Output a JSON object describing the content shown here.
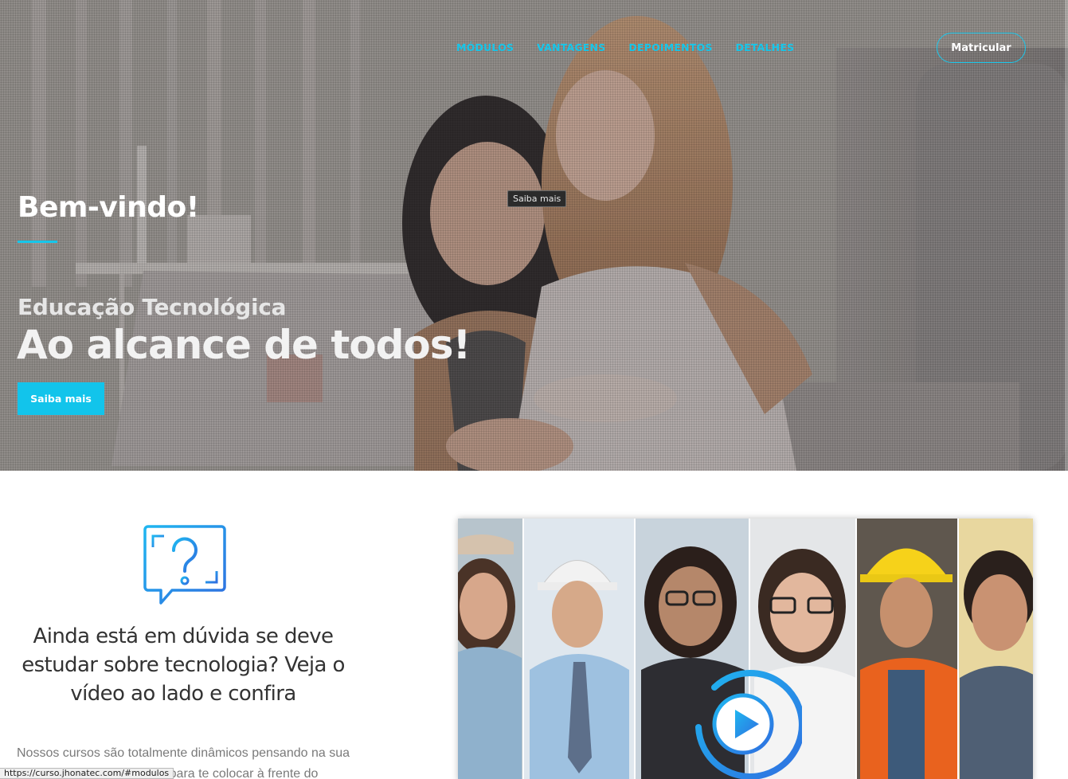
{
  "header": {
    "nav": [
      "MÓDULOS",
      "VANTAGENS",
      "DEPOIMENTOS",
      "DETALHES"
    ],
    "enroll_button": "Matricular"
  },
  "hero": {
    "welcome": "Bem-vindo!",
    "subtitle": "Educação Tecnológica",
    "headline": "Ao alcance de todos!",
    "cta_button": "Saiba mais",
    "tooltip": "Saiba mais"
  },
  "section": {
    "question_title": "Ainda está em dúvida se deve estudar sobre tecnologia? Veja o vídeo ao lado e confira",
    "body_text": "Nossos cursos são totalmente dinâmicos pensando na sua melhor performance, para te colocar à frente do"
  },
  "status_bar": {
    "url": "https://curso.jhonatec.com/#modulos"
  },
  "colors": {
    "accent": "#16c6ea",
    "icon_gradient_start": "#1fb6f0",
    "icon_gradient_end": "#2f6fe0"
  },
  "icons": {
    "question": "question-bubble-icon",
    "play": "play-icon"
  }
}
